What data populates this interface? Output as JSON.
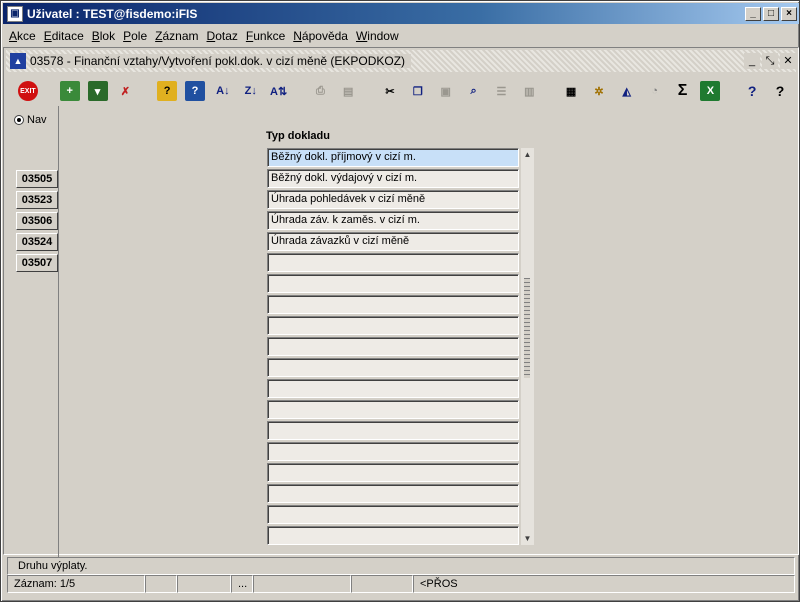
{
  "window": {
    "title": "Uživatel : TEST@fisdemo:iFIS",
    "app_icon": "app-window-icon"
  },
  "menu": [
    "Akce",
    "Editace",
    "Blok",
    "Pole",
    "Záznam",
    "Dotaz",
    "Funkce",
    "Nápověda",
    "Window"
  ],
  "form": {
    "title": "03578 - Finanční vztahy/Vytvoření pokl.dok. v cizí měně (EKPODKOZ)",
    "icon": "form-icon"
  },
  "toolbar": {
    "exit_label": "EXIT",
    "icons": [
      "insert-record-icon",
      "save-icon",
      "delete-record-icon",
      "query-enter-icon",
      "query-execute-icon",
      "sort-asc-icon",
      "sort-desc-icon",
      "sort-multi-icon",
      "print-icon",
      "print-preview-icon",
      "cut-icon",
      "copy-icon",
      "paste-icon",
      "find-icon",
      "list-icon",
      "columns-icon",
      "calculator-icon",
      "settings-icon",
      "chart-icon",
      "clock-icon",
      "sum-icon",
      "excel-icon",
      "help-icon",
      "context-help-icon"
    ]
  },
  "nav": {
    "radio_label": "Nav",
    "buttons": [
      "03505",
      "03523",
      "03506",
      "03524",
      "03507"
    ]
  },
  "block": {
    "label": "Typ dokladu",
    "rows": [
      "Běžný dokl. příjmový v cizí m.",
      "Běžný dokl. výdajový v cizí m.",
      "Úhrada pohledávek v cizí měně",
      "Úhrada záv. k zaměs. v cizí m.",
      "Úhrada závazků v cizí měně",
      "",
      "",
      "",
      "",
      "",
      "",
      "",
      "",
      "",
      "",
      "",
      "",
      "",
      ""
    ]
  },
  "status": {
    "message": "Druhu výplaty.",
    "record": "Záznam: 1/5",
    "ellipsis": "...",
    "mode": "<PŘOS"
  }
}
